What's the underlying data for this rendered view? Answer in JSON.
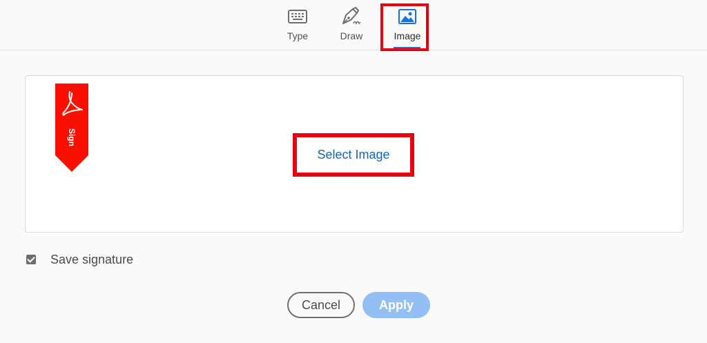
{
  "tabs": [
    {
      "label": "Type",
      "icon": "keyboard-icon"
    },
    {
      "label": "Draw",
      "icon": "pen-draw-icon"
    },
    {
      "label": "Image",
      "icon": "image-icon",
      "selected": true
    }
  ],
  "panel": {
    "ribbon_text": "Sign",
    "select_image_label": "Select Image"
  },
  "save_signature": {
    "label": "Save signature",
    "checked": true
  },
  "buttons": {
    "cancel_label": "Cancel",
    "apply_label": "Apply"
  },
  "colors": {
    "accent_blue": "#1473e6",
    "link_blue": "#1566b7",
    "highlight_red": "#e8000f",
    "ribbon_red": "#fa0f00",
    "apply_disabled": "#93bff5"
  }
}
